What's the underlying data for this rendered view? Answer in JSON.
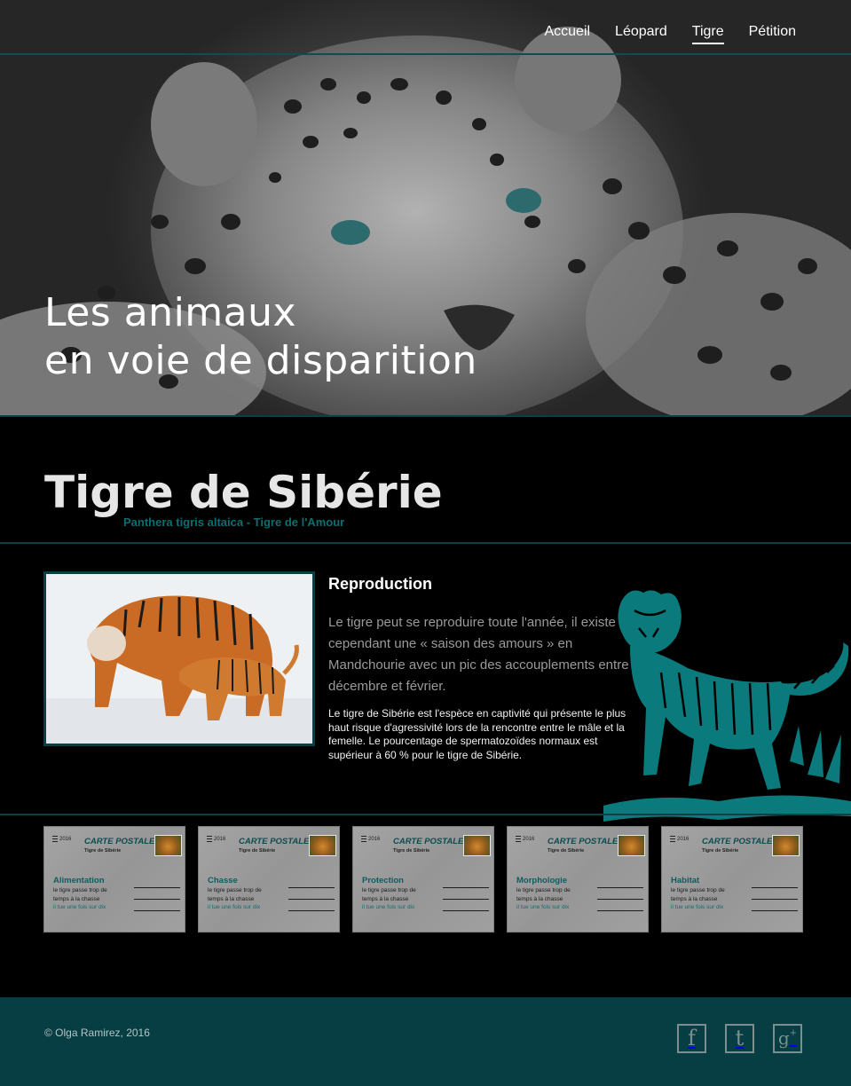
{
  "nav": {
    "items": [
      {
        "label": "Accueil",
        "active": false
      },
      {
        "label": "Léopard",
        "active": false
      },
      {
        "label": "Tigre",
        "active": true
      },
      {
        "label": "Pétition",
        "active": false
      }
    ]
  },
  "hero": {
    "title_line1": "Les animaux",
    "title_line2": "en voie de disparition"
  },
  "section": {
    "title": "Tigre de Sibérie",
    "subtitle": "Panthera tigris altaica - Tigre de l'Amour"
  },
  "content": {
    "heading": "Reproduction",
    "lead": "Le tigre peut se reproduire toute l'année, il existe cependant une « saison des amours » en Mandchourie avec un pic des accouplements entre décembre et février.",
    "body": "Le tigre de Sibérie est l'espèce en captivité qui présente le plus haut risque d'agressivité lors de la rencontre entre le mâle et la femelle. Le pourcentage de spermatozoïdes normaux est supérieur à 60 % pour le tigre de Sibérie."
  },
  "cards": [
    {
      "year": "2016",
      "title": "CARTE POSTALE",
      "subtitle": "Tigre de Sibérie",
      "topic": "Alimentation",
      "desc": "le tigre passe trop de temps à la chasse",
      "note": "il tue une fois sur dix"
    },
    {
      "year": "2016",
      "title": "CARTE POSTALE",
      "subtitle": "Tigre de Sibérie",
      "topic": "Chasse",
      "desc": "le tigre passe trop de temps à la chasse",
      "note": "il tue une fois sur dix"
    },
    {
      "year": "2016",
      "title": "CARTE POSTALE",
      "subtitle": "Tigre de Sibérie",
      "topic": "Protection",
      "desc": "le tigre passe trop de temps à la chasse",
      "note": "il tue une fois sur dix"
    },
    {
      "year": "2016",
      "title": "CARTE POSTALE",
      "subtitle": "Tigre de Sibérie",
      "topic": "Morphologie",
      "desc": "le tigre passe trop de temps à la chasse",
      "note": "il tue une fois sur dix"
    },
    {
      "year": "2016",
      "title": "CARTE POSTALE",
      "subtitle": "Tigre de Sibérie",
      "topic": "Habitat",
      "desc": "le tigre passe trop de temps à la chasse",
      "note": "il tue une fois sur dix"
    }
  ],
  "footer": {
    "copyright": "© Olga Ramirez, 2016",
    "social": [
      {
        "icon": "facebook-icon",
        "glyph": "f"
      },
      {
        "icon": "tumblr-icon",
        "glyph": "t"
      },
      {
        "icon": "google-plus-icon",
        "glyph": "g"
      }
    ]
  },
  "colors": {
    "accent": "#0b3f44",
    "teal": "#0e6e70",
    "footer_bg": "#063e43"
  }
}
